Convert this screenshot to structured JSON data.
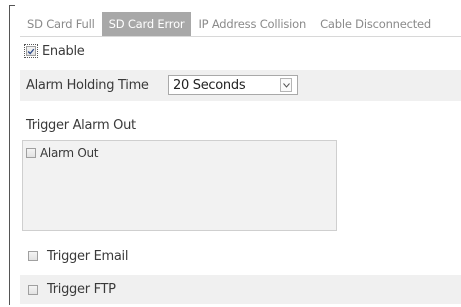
{
  "tabs": [
    {
      "label": "SD Card Full",
      "active": false
    },
    {
      "label": "SD Card Error",
      "active": true
    },
    {
      "label": "IP Address Collision",
      "active": false
    },
    {
      "label": "Cable Disconnected",
      "active": false
    }
  ],
  "enable": {
    "label": "Enable",
    "checked": true
  },
  "alarm_holding_time": {
    "label": "Alarm Holding Time",
    "selected": "20 Seconds"
  },
  "trigger_alarm_out": {
    "label": "Trigger Alarm Out",
    "items": [
      {
        "label": "Alarm Out",
        "checked": false
      }
    ]
  },
  "trigger_email": {
    "label": "Trigger Email",
    "checked": false
  },
  "trigger_ftp": {
    "label": "Trigger FTP",
    "checked": false
  },
  "colors": {
    "active_tab_bg": "#a8a8a8",
    "row_shade": "#f0f0f0"
  }
}
